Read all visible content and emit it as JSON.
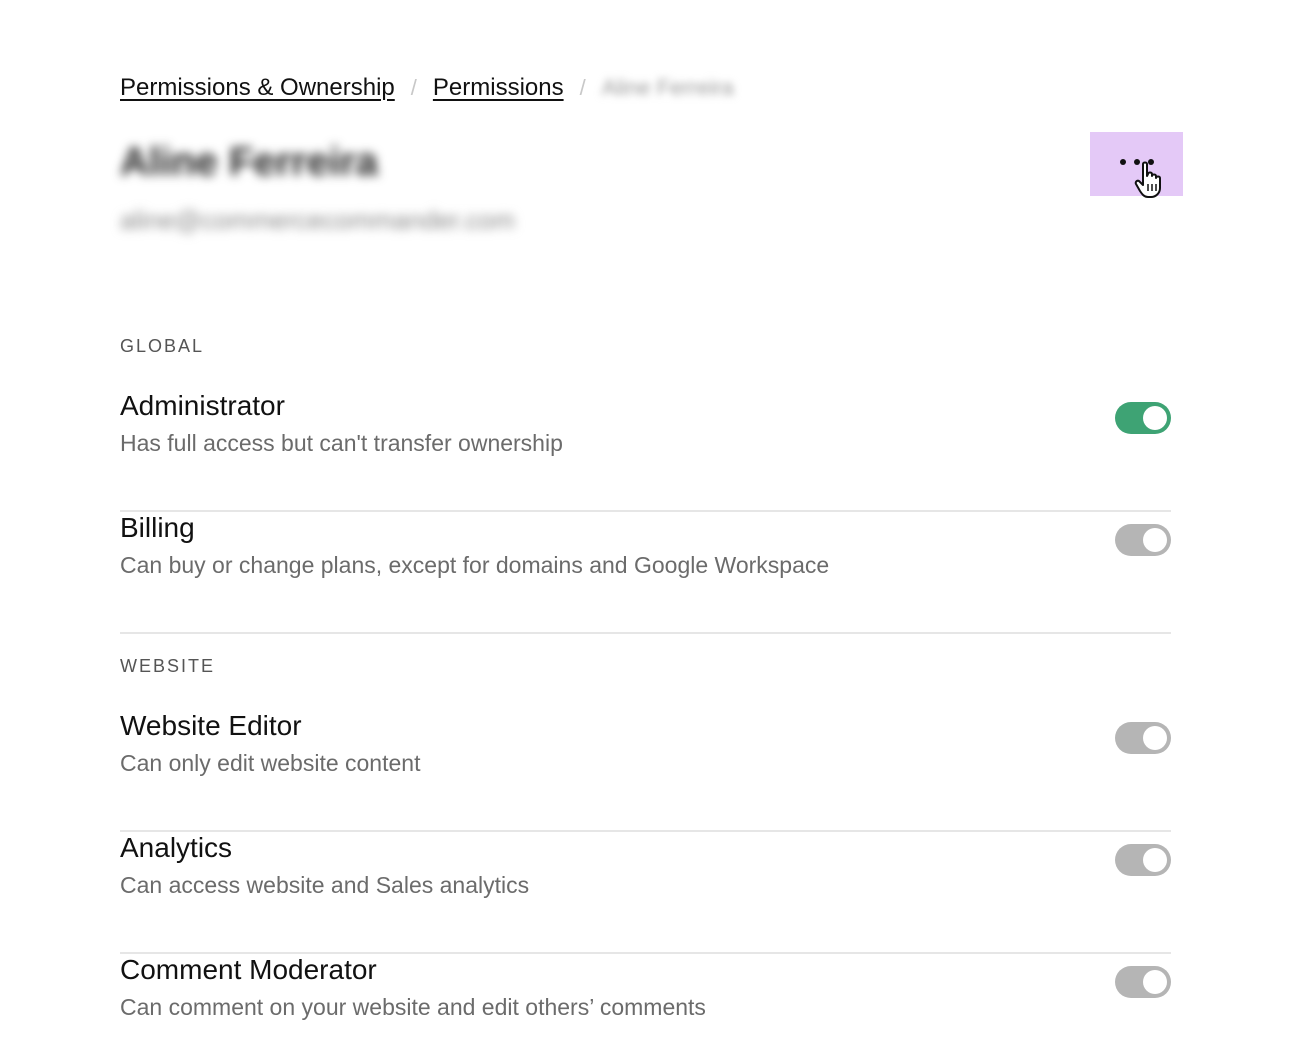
{
  "breadcrumb": {
    "items": [
      "Permissions & Ownership",
      "Permissions"
    ],
    "separator": "/",
    "current": "Aline Ferreira"
  },
  "user": {
    "name": "Aline Ferreira",
    "email": "aline@commercecommander.com"
  },
  "more_button": {
    "icon": "more-horizontal-icon",
    "highlight_color": "#e4c9f7"
  },
  "sections": {
    "global": {
      "label": "GLOBAL",
      "items": [
        {
          "title": "Administrator",
          "description": "Has full access but can't transfer ownership",
          "enabled": true
        },
        {
          "title": "Billing",
          "description": "Can buy or change plans, except for domains and Google Workspace",
          "enabled": false
        }
      ]
    },
    "website": {
      "label": "WEBSITE",
      "items": [
        {
          "title": "Website Editor",
          "description": "Can only edit website content",
          "enabled": false
        },
        {
          "title": "Analytics",
          "description": "Can access website and Sales analytics",
          "enabled": false
        },
        {
          "title": "Comment Moderator",
          "description": "Can comment on your website and edit others’ comments",
          "enabled": false
        }
      ]
    }
  },
  "colors": {
    "toggle_on": "#3ea374",
    "toggle_off": "#b5b5b5"
  }
}
